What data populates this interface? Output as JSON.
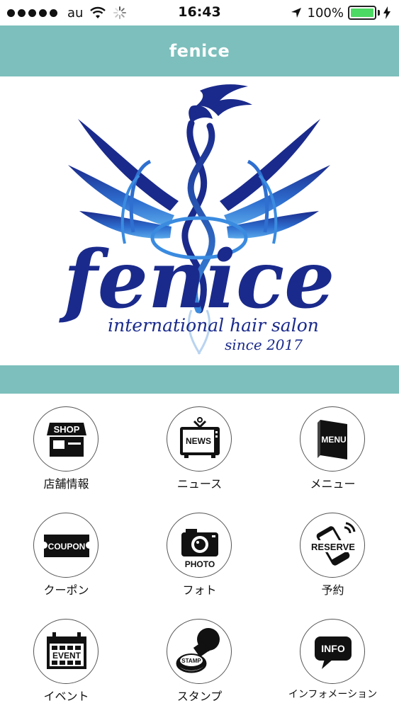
{
  "status_bar": {
    "carrier": "au",
    "time": "16:43",
    "battery": "100%",
    "battery_level": 1.0,
    "icons": [
      "signal-dots-icon",
      "wifi-icon",
      "loading-spinner-icon",
      "location-arrow-icon",
      "battery-icon",
      "charging-bolt-icon"
    ]
  },
  "nav": {
    "title": "fenice"
  },
  "logo": {
    "wordmark": "fenice",
    "tagline": "international hair salon",
    "since": "since 2017",
    "colors": {
      "dark_blue": "#1a2a8c",
      "light_blue": "#3a8be0"
    }
  },
  "colors": {
    "accent": "#7cbfbc",
    "icon_black": "#111111"
  },
  "menu": {
    "items": [
      {
        "label": "店舗情報",
        "icon_text": "SHOP",
        "icon": "shop-icon"
      },
      {
        "label": "ニュース",
        "icon_text": "NEWS",
        "icon": "news-tv-icon"
      },
      {
        "label": "メニュー",
        "icon_text": "MENU",
        "icon": "menu-book-icon"
      },
      {
        "label": "クーポン",
        "icon_text": "COUPON",
        "icon": "coupon-icon"
      },
      {
        "label": "フォト",
        "icon_text": "PHOTO",
        "icon": "camera-icon"
      },
      {
        "label": "予約",
        "icon_text": "RESERVE",
        "icon": "reserve-phone-icon"
      },
      {
        "label": "イベント",
        "icon_text": "EVENT",
        "icon": "event-calendar-icon"
      },
      {
        "label": "スタンプ",
        "icon_text": "STAMP",
        "icon": "stamp-icon"
      },
      {
        "label": "インフォメーション",
        "icon_text": "INFO",
        "icon": "info-bubble-icon"
      }
    ]
  }
}
